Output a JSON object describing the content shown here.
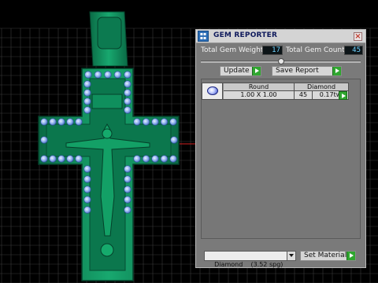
{
  "viewport": {
    "description_colors": {
      "background": "#000000",
      "grid": "#3a3a3a",
      "model_body": "#0f8a5c",
      "gem": "#7fa8e8",
      "axis_red": "#d21f1f"
    },
    "gem_count_rendered": 45
  },
  "gem_reporter": {
    "logo_icon": "app-logo-icon",
    "title": "GEM REPORTER",
    "close_icon": "close-icon",
    "total_weight_label": "Total Gem Weight",
    "total_weight_value": "17",
    "total_count_label": "Total Gem Count",
    "total_count_value": "45",
    "slider_position": 0.5,
    "update_label": "Update",
    "save_report_label": "Save Report",
    "table": {
      "headers": [
        "Round",
        "Diamond"
      ],
      "row": {
        "size": "1.00 X 1.00",
        "count": "45",
        "weight": "0.17tw"
      }
    },
    "material_select_value": "Diamond    (3.52 spg)",
    "set_material_label": "Set Material"
  }
}
